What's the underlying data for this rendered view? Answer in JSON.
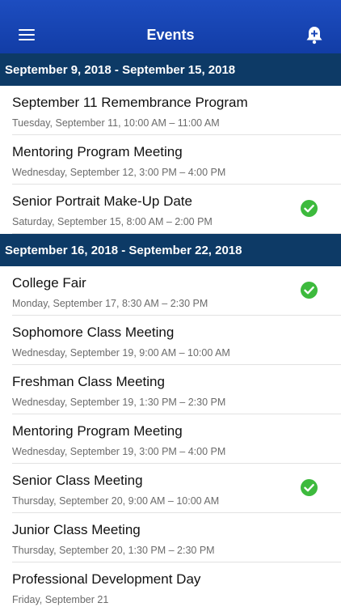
{
  "header": {
    "title": "Events",
    "menu_icon": "hamburger-menu-icon",
    "action_icon": "bell-plus-icon"
  },
  "colors": {
    "nav": "#1a47b8",
    "week_header": "#0d3a66",
    "check": "#3dba3d"
  },
  "weeks": [
    {
      "label": "September 9, 2018 - September 15, 2018",
      "events": [
        {
          "title": "September 11 Remembrance Program",
          "time": "Tuesday, September 11, 10:00 AM – 11:00 AM",
          "checked": false
        },
        {
          "title": "Mentoring Program Meeting",
          "time": "Wednesday, September 12, 3:00 PM – 4:00 PM",
          "checked": false
        },
        {
          "title": "Senior Portrait Make-Up Date",
          "time": "Saturday, September 15, 8:00 AM – 2:00 PM",
          "checked": true
        }
      ]
    },
    {
      "label": "September 16, 2018 - September 22, 2018",
      "events": [
        {
          "title": "College Fair",
          "time": "Monday, September 17, 8:30 AM – 2:30 PM",
          "checked": true
        },
        {
          "title": "Sophomore Class Meeting",
          "time": "Wednesday, September 19, 9:00 AM – 10:00 AM",
          "checked": false
        },
        {
          "title": "Freshman Class Meeting",
          "time": "Wednesday, September 19, 1:30 PM – 2:30 PM",
          "checked": false
        },
        {
          "title": "Mentoring Program Meeting",
          "time": "Wednesday, September 19, 3:00 PM – 4:00 PM",
          "checked": false
        },
        {
          "title": "Senior Class Meeting",
          "time": "Thursday, September 20, 9:00 AM – 10:00 AM",
          "checked": true
        },
        {
          "title": "Junior Class Meeting",
          "time": "Thursday, September 20, 1:30 PM – 2:30 PM",
          "checked": false
        },
        {
          "title": "Professional Development Day",
          "time": "Friday, September 21",
          "checked": false
        }
      ]
    }
  ]
}
